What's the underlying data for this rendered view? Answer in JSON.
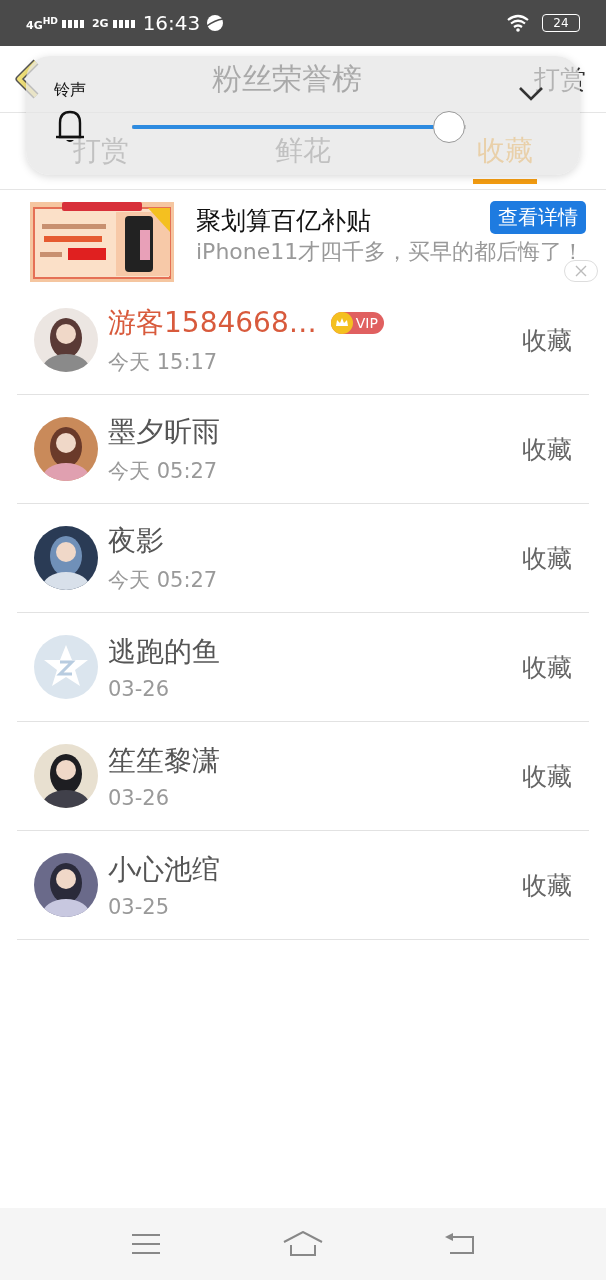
{
  "status_bar": {
    "networks": [
      "4G$^{HD}$",
      "2G"
    ],
    "time": "16:43",
    "battery": "24"
  },
  "header": {
    "title": "粉丝荣誉榜",
    "action": "打赏"
  },
  "tabs": [
    {
      "label": "打赏",
      "selected": false
    },
    {
      "label": "鲜花",
      "selected": false
    },
    {
      "label": "收藏",
      "selected": true
    }
  ],
  "ad": {
    "title": "聚划算百亿补贴",
    "button": "查看详情",
    "description": "iPhone11才四千多，买早的都后悔了！"
  },
  "fans": [
    {
      "name": "游客1584668…",
      "vip": true,
      "vip_label": "VIP",
      "time": "今天 15:17",
      "action": "收藏"
    },
    {
      "name": "墨夕昕雨",
      "vip": false,
      "time": "今天 05:27",
      "action": "收藏"
    },
    {
      "name": "夜影",
      "vip": false,
      "time": "今天 05:27",
      "action": "收藏"
    },
    {
      "name": "逃跑的鱼",
      "vip": false,
      "time": "03-26",
      "action": "收藏",
      "avatar": {
        "kind": "icon"
      }
    },
    {
      "name": "笙笙黎潇",
      "vip": false,
      "time": "03-26",
      "action": "收藏"
    },
    {
      "name": "小心池绾",
      "vip": false,
      "time": "03-25",
      "action": "收藏"
    }
  ],
  "volume_panel": {
    "title": "铃声",
    "level": 0.95
  }
}
